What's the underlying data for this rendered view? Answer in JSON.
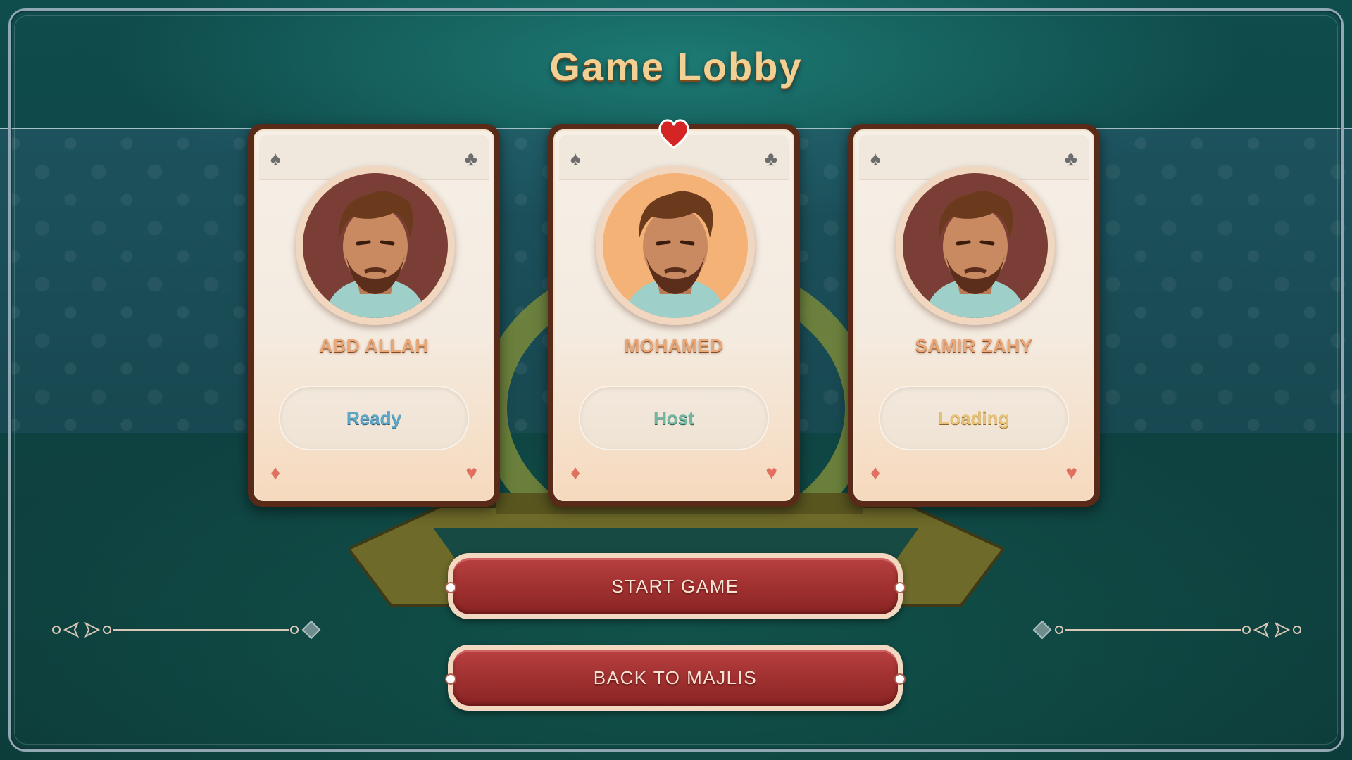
{
  "lobby": {
    "title": "Game Lobby"
  },
  "players": [
    {
      "name": "ABD ALLAH",
      "status": "Ready",
      "status_kind": "ready",
      "is_host": false
    },
    {
      "name": "MOHAMED",
      "status": "Host",
      "status_kind": "host",
      "is_host": true
    },
    {
      "name": "SAMIR ZAHY",
      "status": "Loading",
      "status_kind": "loading",
      "is_host": false
    }
  ],
  "buttons": {
    "start_label": "START GAME",
    "back_label": "BACK TO MAJLIS"
  },
  "suits": {
    "top_left": "♠",
    "top_right": "♣",
    "bottom_left": "♦",
    "bottom_right": "♥"
  },
  "colors": {
    "accent_title": "#f2cf93",
    "button_red": "#a33232",
    "status_ready": "#5ea6c8",
    "status_host": "#74b6a4",
    "status_loading": "#e8c27a"
  }
}
